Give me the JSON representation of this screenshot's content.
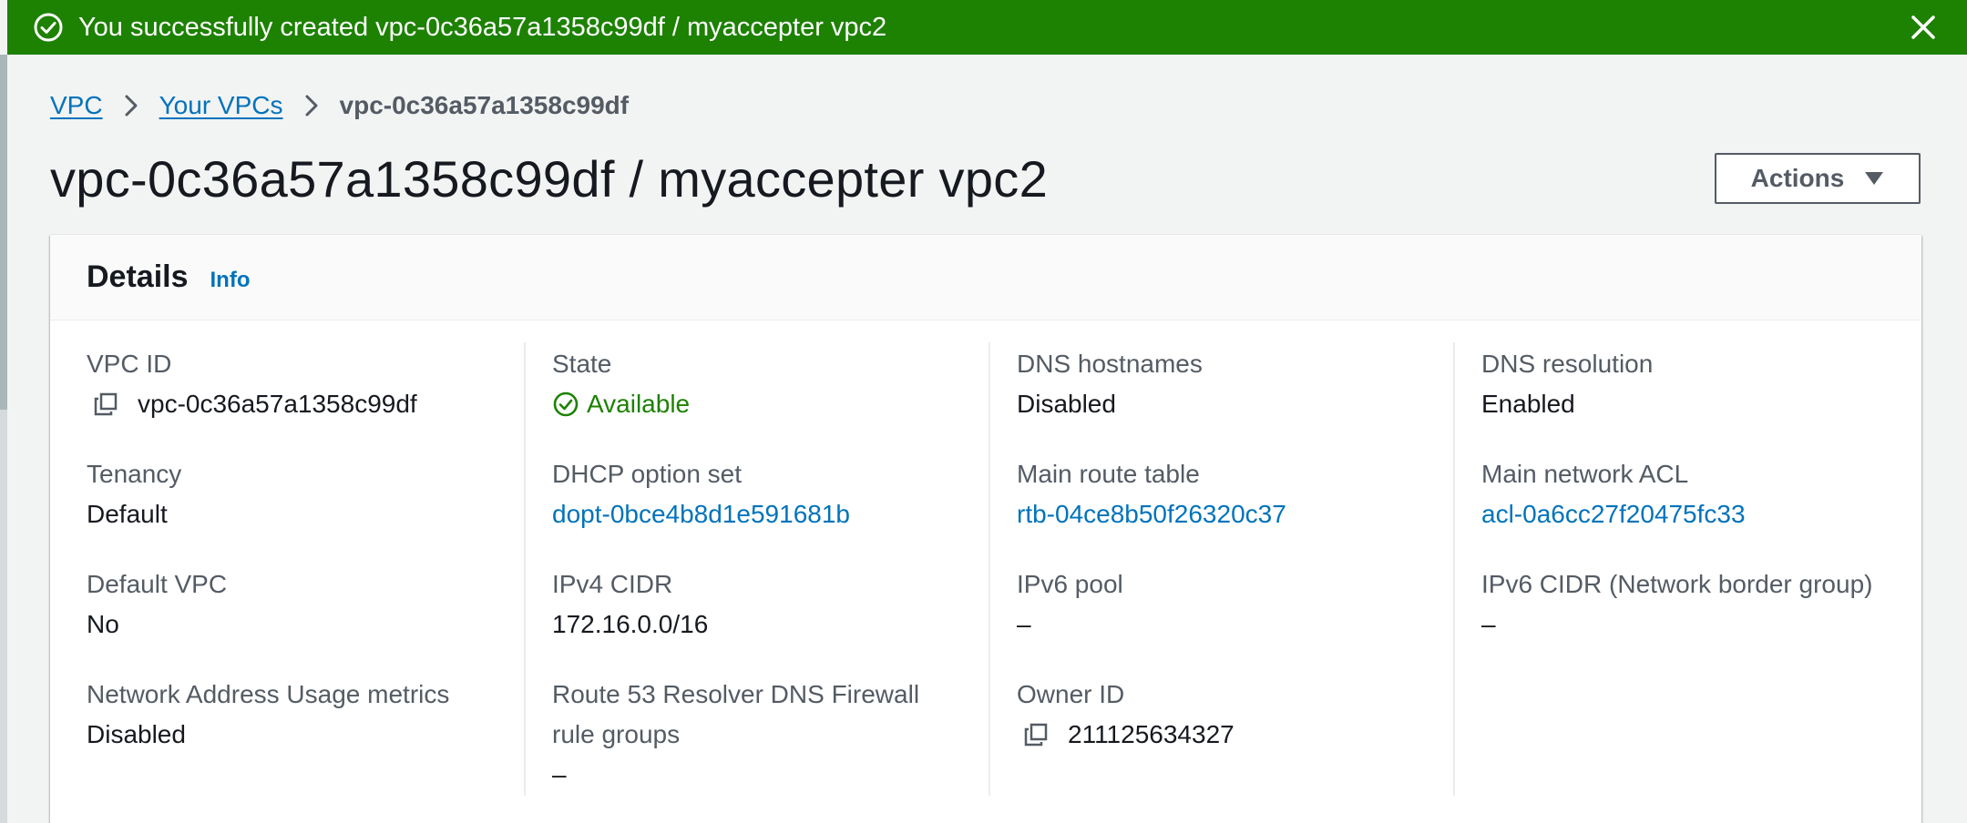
{
  "flash": {
    "message": "You successfully created vpc-0c36a57a1358c99df / myaccepter vpc2",
    "icon": "check-circle-icon",
    "close_icon": "close-icon",
    "color": "#1d8102"
  },
  "breadcrumb": {
    "items": [
      "VPC",
      "Your VPCs"
    ],
    "current": "vpc-0c36a57a1358c99df"
  },
  "page": {
    "title": "vpc-0c36a57a1358c99df / myaccepter vpc2",
    "actions_label": "Actions"
  },
  "details": {
    "heading": "Details",
    "info_label": "Info",
    "vpc_id": {
      "label": "VPC ID",
      "value": "vpc-0c36a57a1358c99df"
    },
    "tenancy": {
      "label": "Tenancy",
      "value": "Default"
    },
    "default_vpc": {
      "label": "Default VPC",
      "value": "No"
    },
    "nau_metrics": {
      "label": "Network Address Usage metrics",
      "value": "Disabled"
    },
    "state": {
      "label": "State",
      "value": "Available"
    },
    "dhcp": {
      "label": "DHCP option set",
      "value": "dopt-0bce4b8d1e591681b"
    },
    "ipv4_cidr": {
      "label": "IPv4 CIDR",
      "value": "172.16.0.0/16"
    },
    "route53": {
      "label_line1": "Route 53 Resolver DNS Firewall",
      "label_line2": "rule groups",
      "value": "–"
    },
    "dns_hostnames": {
      "label": "DNS hostnames",
      "value": "Disabled"
    },
    "main_route_table": {
      "label": "Main route table",
      "value": "rtb-04ce8b50f26320c37"
    },
    "ipv6_pool": {
      "label": "IPv6 pool",
      "value": "–"
    },
    "owner_id": {
      "label": "Owner ID",
      "value": "211125634327"
    },
    "dns_resolution": {
      "label": "DNS resolution",
      "value": "Enabled"
    },
    "main_network_acl": {
      "label": "Main network ACL",
      "value": "acl-0a6cc27f20475fc33"
    },
    "ipv6_cidr": {
      "label": "IPv6 CIDR (Network border group)",
      "value": "–"
    }
  },
  "colors": {
    "link": "#0073bb",
    "success": "#1d8102",
    "label": "#545b64",
    "text": "#16191f"
  }
}
